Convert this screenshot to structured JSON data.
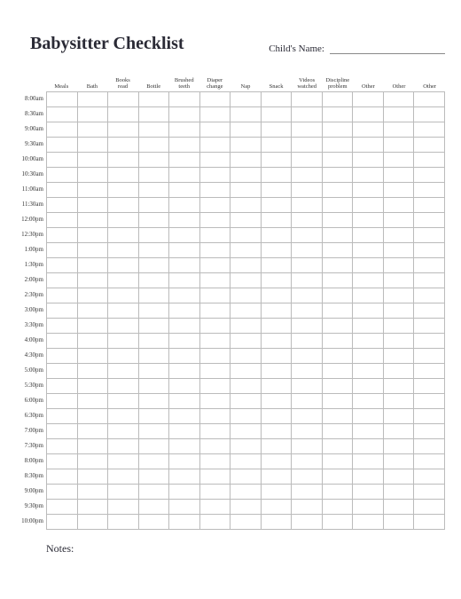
{
  "title": "Babysitter Checklist",
  "child_name_label": "Child's Name:",
  "child_name_value": "",
  "columns": [
    "Meals",
    "Bath",
    "Books\nread",
    "Bottle",
    "Brushed\nteeth",
    "Diaper\nchange",
    "Nap",
    "Snack",
    "Videos\nwatched",
    "Discipline\nproblem",
    "Other",
    "Other",
    "Other"
  ],
  "times": [
    "8:00am",
    "8:30am",
    "9:00am",
    "9:30am",
    "10:00am",
    "10:30am",
    "11:00am",
    "11:30am",
    "12:00pm",
    "12:30pm",
    "1:00pm",
    "1:30pm",
    "2:00pm",
    "2:30pm",
    "3:00pm",
    "3:30pm",
    "4:00pm",
    "4:30pm",
    "5:00pm",
    "5:30pm",
    "6:00pm",
    "6:30pm",
    "7:00pm",
    "7:30pm",
    "8:00pm",
    "8:30pm",
    "9:00pm",
    "9:30pm",
    "10:00pm"
  ],
  "notes_label": "Notes:"
}
